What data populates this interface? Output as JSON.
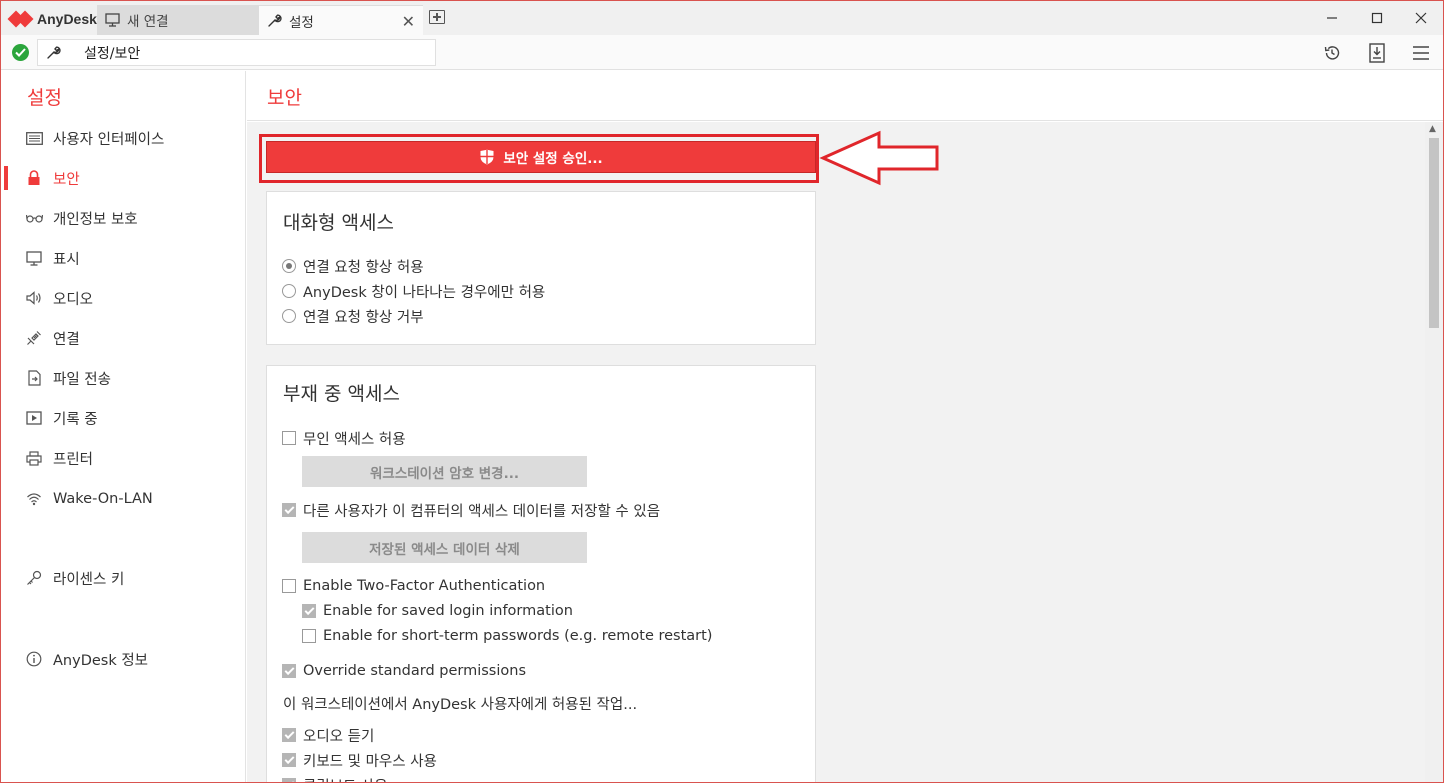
{
  "app": {
    "name": "AnyDesk"
  },
  "tabs": [
    {
      "label": "새 연결",
      "icon": "monitor-icon"
    },
    {
      "label": "설정",
      "icon": "wrench-icon"
    }
  ],
  "address": {
    "text": "설정/보안"
  },
  "sidebar": {
    "title": "설정",
    "items": [
      {
        "label": "사용자 인터페이스",
        "icon": "keyboard-icon"
      },
      {
        "label": "보안",
        "icon": "lock-icon"
      },
      {
        "label": "개인정보 보호",
        "icon": "glasses-icon"
      },
      {
        "label": "표시",
        "icon": "monitor-icon"
      },
      {
        "label": "오디오",
        "icon": "speaker-icon"
      },
      {
        "label": "연결",
        "icon": "connection-icon"
      },
      {
        "label": "파일 전송",
        "icon": "file-transfer-icon"
      },
      {
        "label": "기록 중",
        "icon": "recording-icon"
      },
      {
        "label": "프린터",
        "icon": "printer-icon"
      },
      {
        "label": "Wake-On-LAN",
        "icon": "wifi-icon"
      },
      {
        "label": "라이센스 키",
        "icon": "key-icon"
      },
      {
        "label": "AnyDesk 정보",
        "icon": "info-icon"
      }
    ],
    "active_index": 1
  },
  "main": {
    "title": "보안",
    "approve_button": "보안 설정 승인...",
    "interactive": {
      "title": "대화형 액세스",
      "options": [
        {
          "label": "연결 요청 항상 허용",
          "selected": true
        },
        {
          "label": "AnyDesk 창이 나타나는 경우에만 허용",
          "selected": false
        },
        {
          "label": "연결 요청 항상 거부",
          "selected": false
        }
      ]
    },
    "unattended": {
      "title": "부재 중 액세스",
      "allow_unattended": {
        "label": "무인 액세스 허용",
        "checked": false
      },
      "change_password_button": "워크스테이션 암호 변경...",
      "save_access_data": {
        "label": "다른 사용자가 이 컴퓨터의 액세스 데이터를 저장할 수 있음",
        "checked": true
      },
      "delete_access_data_button": "저장된 액세스 데이터 삭제",
      "two_factor": {
        "label": "Enable Two-Factor Authentication",
        "checked": false
      },
      "two_factor_saved": {
        "label": "Enable for saved login information",
        "checked": true
      },
      "two_factor_short": {
        "label": "Enable for short-term passwords (e.g. remote restart)",
        "checked": false
      },
      "override": {
        "label": "Override standard permissions",
        "checked": true
      },
      "permissions_heading": "이 워크스테이션에서 AnyDesk 사용자에게 허용된 작업...",
      "permissions": [
        {
          "label": "오디오 듣기",
          "checked": true
        },
        {
          "label": "키보드 및 마우스 사용",
          "checked": true
        },
        {
          "label": "클립보드 사용",
          "checked": true
        }
      ]
    }
  },
  "colors": {
    "accent": "#ef3b3b",
    "annotation": "#e0262b",
    "status_ok": "#2ba53c"
  }
}
